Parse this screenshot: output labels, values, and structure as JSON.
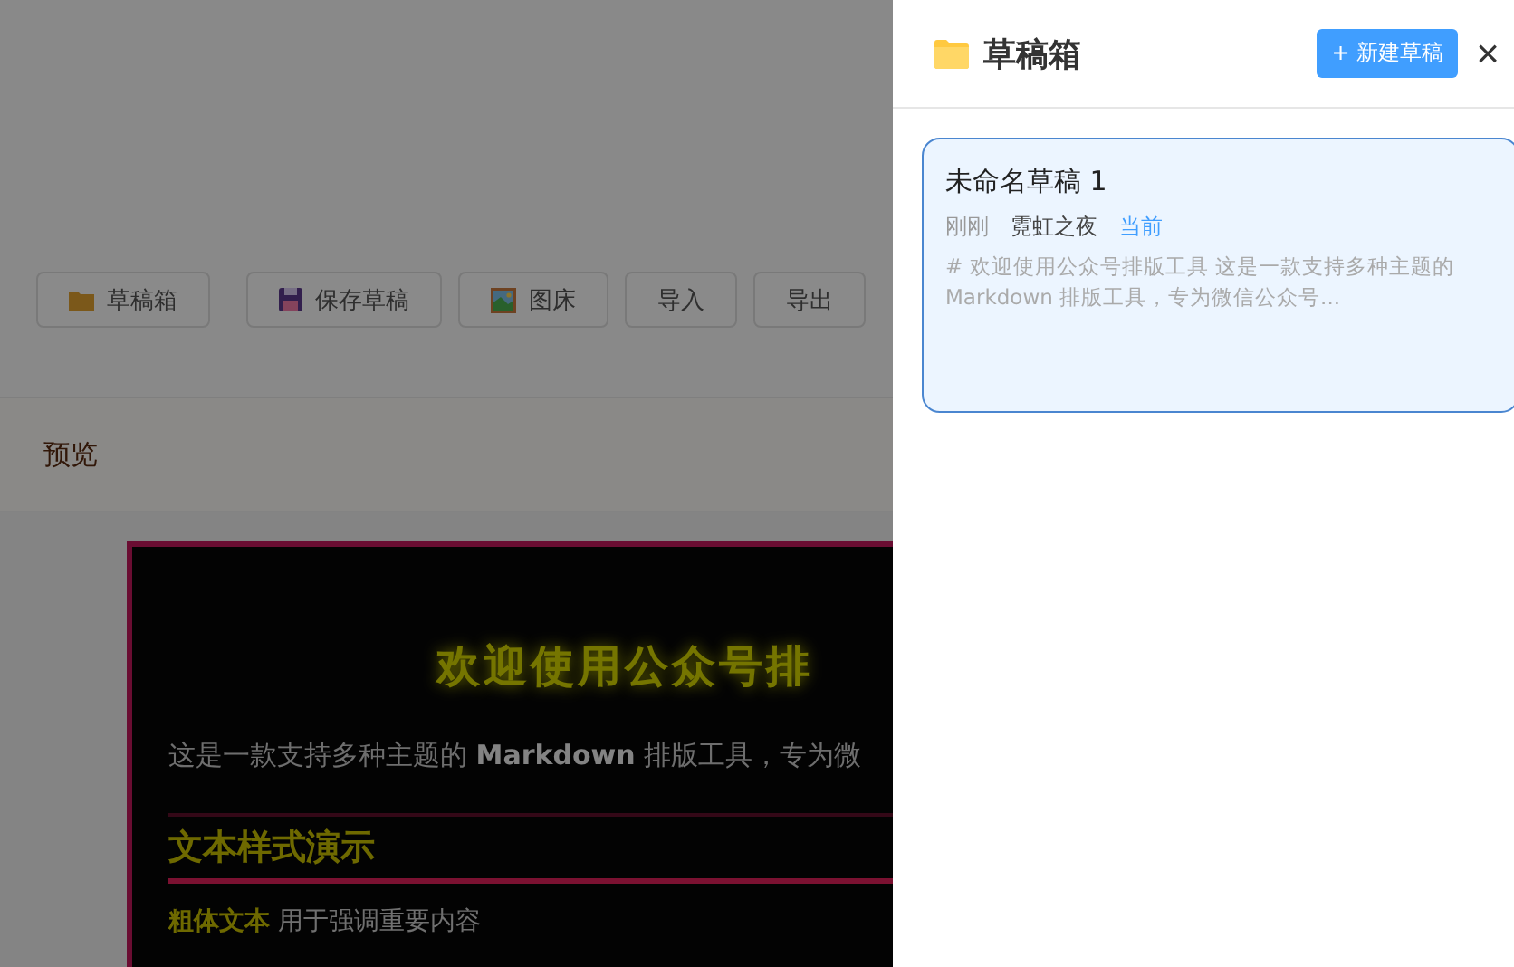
{
  "toolbar": {
    "buttons": [
      {
        "label": "草稿箱",
        "kind": "folder"
      },
      {
        "label": "保存草稿",
        "kind": "save"
      },
      {
        "label": "图床",
        "kind": "image"
      },
      {
        "label": "导入",
        "kind": "plain"
      },
      {
        "label": "导出",
        "kind": "plain"
      }
    ]
  },
  "preview": {
    "title": "预览",
    "article": {
      "heading": "欢迎使用公众号排",
      "intro": "这是一款支持多种主题的 **Markdown** 排版工具，专为微",
      "section_heading": "文本样式演示",
      "bold_text": "粗体文本",
      "text": "用于强调重要内容"
    }
  },
  "drafts_panel": {
    "title": "草稿箱",
    "new_button": "+ 新建草稿",
    "close": "×",
    "drafts": [
      {
        "title": "未命名草稿 1",
        "time": "刚刚",
        "theme": "霓虹之夜",
        "current_badge": "当前",
        "excerpt": "# 欢迎使用公众号排版工具 这是一款支持多种主题的 Markdown 排版工具，专为微信公众号...",
        "selected": true
      }
    ]
  }
}
